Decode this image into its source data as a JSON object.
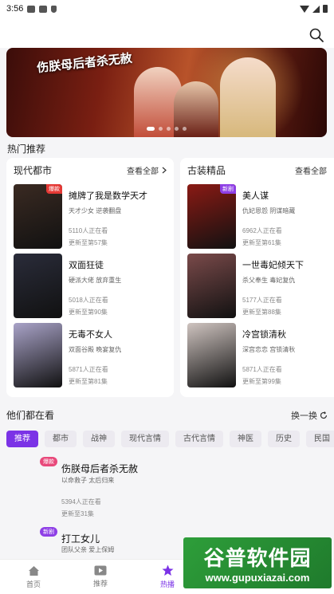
{
  "status_bar": {
    "time": "3:56"
  },
  "banner": {
    "title": "伤朕母后者杀无赦"
  },
  "section_hot": "热门推荐",
  "cards": [
    {
      "name": "现代都市",
      "see_all": "查看全部",
      "items": [
        {
          "title": "摊牌了我是数学天才",
          "tags": "天才少女 逆袭翻盘",
          "views": "5110人正在看",
          "ep": "更新至第57集",
          "badge": "爆款",
          "badge_color": "#e53935",
          "poster_color": "#3a2a22"
        },
        {
          "title": "双面狂徒",
          "tags": "硬派大佬 放弃重生",
          "views": "5018人正在看",
          "ep": "更新至第90集",
          "badge": "",
          "badge_color": "",
          "poster_color": "#2a2c3a"
        },
        {
          "title": "无毒不女人",
          "tags": "双面谷殿 晚宴复仇",
          "views": "5871人正在看",
          "ep": "更新至第81集",
          "badge": "",
          "badge_color": "",
          "poster_color": "#a9a3c8"
        }
      ]
    },
    {
      "name": "古装精品",
      "see_all": "查看全部",
      "items": [
        {
          "title": "美人谋",
          "tags": "仇妃恩怨 阴谋暗藏",
          "views": "6962人正在看",
          "ep": "更新至第61集",
          "badge": "新剧",
          "badge_color": "#8e3fe6",
          "poster_color": "#8a1a14"
        },
        {
          "title": "一世毒妃倾天下",
          "tags": "杀父奉生 毒妃复仇",
          "views": "5177人正在看",
          "ep": "更新至第88集",
          "badge": "",
          "badge_color": "",
          "poster_color": "#7a4a4a"
        },
        {
          "title": "冷宫锁清秋",
          "tags": "深宫恋恋 宫锁清秋",
          "views": "5871人正在看",
          "ep": "更新至第99集",
          "badge": "",
          "badge_color": "",
          "poster_color": "#cfc4c0"
        }
      ]
    }
  ],
  "watching": {
    "title": "他们都在看",
    "refresh": "换一换"
  },
  "chips": [
    "推荐",
    "都市",
    "战神",
    "现代言情",
    "古代言情",
    "神医",
    "历史",
    "民国"
  ],
  "list": [
    {
      "badge": "爆款",
      "title": "伤朕母后者杀无赦",
      "tags": "以命救子 太后归来",
      "views": "5394人正在看",
      "ep": "更新至31集"
    },
    {
      "badge": "新剧",
      "title": "打工女儿",
      "tags": "团队父亲 爱上保姆"
    }
  ],
  "nav": [
    {
      "label": "首页",
      "icon": "home-icon"
    },
    {
      "label": "推荐",
      "icon": "play-icon"
    },
    {
      "label": "热播",
      "icon": "star-icon"
    }
  ],
  "watermark": {
    "name": "谷普软件园",
    "url": "www.gupuxiazai.com"
  }
}
